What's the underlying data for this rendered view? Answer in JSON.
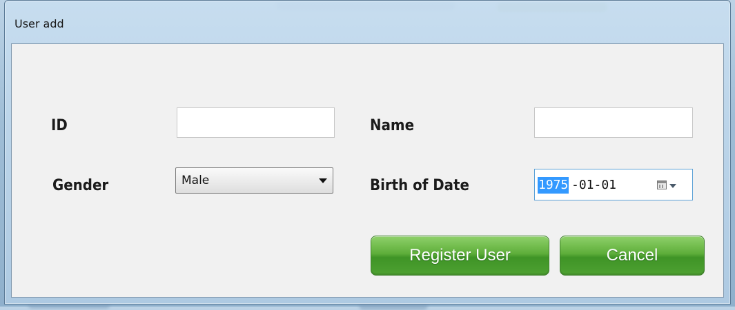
{
  "window": {
    "title": "User add"
  },
  "form": {
    "id_label": "ID",
    "id_value": "",
    "name_label": "Name",
    "name_value": "",
    "gender_label": "Gender",
    "gender_value": "Male",
    "birth_label": "Birth of Date",
    "birth_year": "1975",
    "birth_rest": "-01-01"
  },
  "buttons": {
    "register_label": "Register User",
    "cancel_label": "Cancel"
  },
  "colors": {
    "button_green": "#4ea132",
    "selection_blue": "#3399ff",
    "focus_border": "#5aa0d6"
  }
}
